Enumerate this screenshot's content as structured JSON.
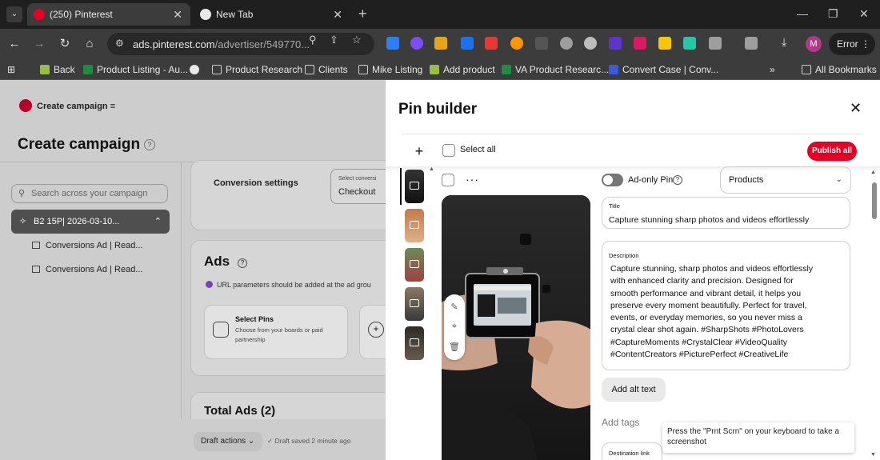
{
  "browser": {
    "tabs": [
      {
        "title": "(250) Pinterest",
        "active": true
      },
      {
        "title": "New Tab",
        "active": false
      }
    ],
    "url": {
      "host": "ads.pinterest.com",
      "path": "/advertiser/549770..."
    },
    "error_button": "Error",
    "profile_initial": "M",
    "bookmarks": [
      "Back",
      "Product Listing - Au...",
      "Product Research",
      "Clients",
      "Mike Listing",
      "Add product",
      "VA Product Researc...",
      "Convert Case | Conv..."
    ],
    "all_bookmarks": "All Bookmarks",
    "overflow": "»"
  },
  "left": {
    "brand": "Create campaign",
    "menu_icon": "≡",
    "heading": "Create campaign",
    "help": "?",
    "search_placeholder": "Search across your campaign",
    "campaign_name": "B2 15P| 2026-03-10...",
    "ad_groups": [
      "Conversions Ad | Read...",
      "Conversions Ad | Read..."
    ],
    "conversion": {
      "label": "Conversion settings",
      "select_label": "Select conversi",
      "select_value": "Checkout"
    },
    "ads": {
      "title": "Ads",
      "note": "URL parameters should be added at the ad grou",
      "select_pins_title": "Select Pins",
      "select_pins_desc": "Choose from your boards or paid partnership"
    },
    "total_ads": "Total Ads (2)",
    "draft_actions": "Draft actions",
    "draft_saved": "Draft saved 2 minute ago"
  },
  "pin_builder": {
    "title": "Pin builder",
    "select_all": "Select all",
    "publish_all": "Publish all",
    "ad_only": "Ad-only Pin",
    "products_select": "Products",
    "title_label": "Title",
    "title_value": "Capture stunning sharp photos and videos effortlessly",
    "description_label": "Description",
    "description_lines": [
      "Capture stunning, sharp photos and videos effortlessly",
      "with enhanced clarity and precision. Designed for",
      "smooth performance and vibrant detail, it helps you",
      "preserve every moment beautifully. Perfect for travel,",
      "events, or everyday memories, so you never miss a",
      "crystal clear shot again. #SharpShots #PhotoLovers",
      "#CaptureMoments #CrystalClear #VideoQuality",
      "#ContentCreators #PicturePerfect #CreativeLife"
    ],
    "alt_text_button": "Add alt text",
    "add_tags": "Add tags",
    "destination_label": "Destination link",
    "thumbnail_count": 5
  },
  "tooltip": "Press the \"Prnt Scrn\" on your keyboard to take a screenshot",
  "colors": {
    "publish": "#e60023",
    "pinterest_red": "#e60023",
    "overlay": "#cdcdcd"
  }
}
